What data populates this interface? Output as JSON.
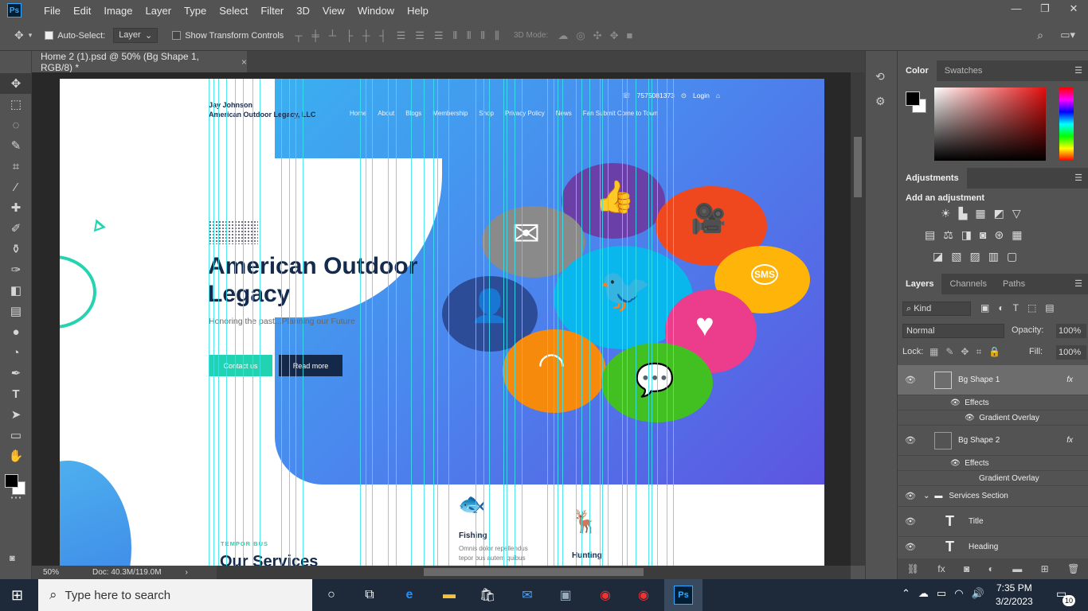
{
  "app": {
    "logo": "Ps"
  },
  "menu": [
    "File",
    "Edit",
    "Image",
    "Layer",
    "Type",
    "Select",
    "Filter",
    "3D",
    "View",
    "Window",
    "Help"
  ],
  "window_controls": {
    "minimize": "—",
    "restore": "❐",
    "close": "✕"
  },
  "options": {
    "auto_select_label": "Auto-Select:",
    "auto_select_value": "Layer",
    "transform_label": "Show Transform Controls",
    "mode_3d": "3D Mode:"
  },
  "document_tab": {
    "title": "Home 2 (1).psd @ 50% (Bg Shape 1, RGB/8) *",
    "close": "×"
  },
  "status": {
    "zoom": "50%",
    "doc": "Doc: 40.3M/119.0M"
  },
  "site": {
    "brand_name": "Jay Johnson",
    "brand_company": "American Outdoor Legacy, LLC",
    "nav": [
      "Home",
      "About",
      "Blogs",
      "Membership",
      "Shop",
      "Privacy Policy",
      "News",
      "Fan Submit Come to Town"
    ],
    "phone": "7575081373",
    "login": "Login",
    "hero_title": "American Outdoor Legacy",
    "hero_subtitle": "Honoring the past...Planning our Future",
    "btn_contact": "Contact us",
    "btn_read": "Read more",
    "services_tag": "TEMPOR BUS",
    "services_title": "Our Services",
    "fishing_title": "Fishing",
    "fishing_desc_1": "Omnis dolor repellendus",
    "fishing_desc_2": "tepor bus autem quibus",
    "hunting_title": "Hunting",
    "bubble_sms": "SMS"
  },
  "color_panel": {
    "tabs": [
      "Color",
      "Swatches"
    ]
  },
  "adjustments": {
    "title": "Adjustments",
    "hint": "Add an adjustment"
  },
  "layers_panel": {
    "tabs": [
      "Layers",
      "Channels",
      "Paths"
    ],
    "kind": "Kind",
    "blend": "Normal",
    "opacity_label": "Opacity:",
    "opacity_value": "100%",
    "lock_label": "Lock:",
    "fill_label": "Fill:",
    "fill_value": "100%",
    "layers": [
      {
        "name": "Bg Shape 1",
        "fx": "fx",
        "effects": "Effects",
        "effect": "Gradient Overlay"
      },
      {
        "name": "Bg Shape 2",
        "fx": "fx",
        "effects": "Effects",
        "effect": "Gradient Overlay"
      },
      {
        "name": "Services Section"
      },
      {
        "name": "Title"
      },
      {
        "name": "Heading"
      }
    ]
  },
  "taskbar": {
    "search_placeholder": "Type here to search",
    "time": "7:35 PM",
    "date": "3/2/2023",
    "notifications": "10"
  },
  "colors": {
    "accent_teal": "#22d3b1",
    "navy": "#152b4d",
    "guide": "#37e3ec"
  }
}
